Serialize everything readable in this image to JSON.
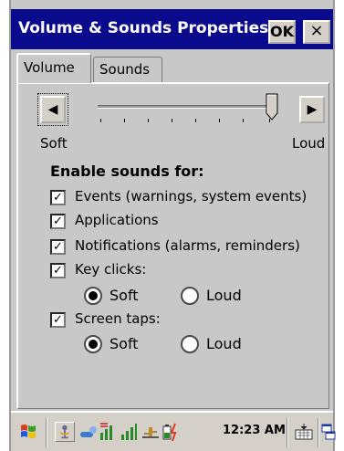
{
  "window": {
    "title": "Volume & Sounds Properties",
    "ok_label": "OK",
    "close_label": "×"
  },
  "tabs": [
    {
      "label": "Volume",
      "active": true
    },
    {
      "label": "Sounds",
      "active": false
    }
  ],
  "volume": {
    "left_arrow": "◀",
    "right_arrow": "▶",
    "min_label": "Soft",
    "max_label": "Loud",
    "level": 0.95
  },
  "heading": "Enable sounds for:",
  "options": [
    {
      "label": "Events (warnings, system events)",
      "checked": true
    },
    {
      "label": "Applications",
      "checked": true
    },
    {
      "label": "Notifications (alarms, reminders)",
      "checked": true
    },
    {
      "label": "Key clicks:",
      "checked": true
    },
    {
      "label": "Screen taps:",
      "checked": true
    }
  ],
  "key_clicks": {
    "soft": "Soft",
    "loud": "Loud",
    "selected": "Soft"
  },
  "screen_taps": {
    "soft": "Soft",
    "loud": "Loud",
    "selected": "Soft"
  },
  "checkmark": "✓",
  "taskbar": {
    "time": "12:23 AM"
  }
}
